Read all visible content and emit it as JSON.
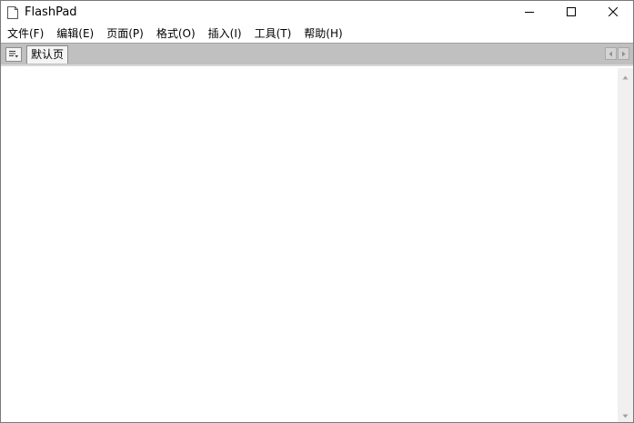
{
  "window": {
    "title": "FlashPad"
  },
  "icons": {
    "app": "document-icon",
    "minimize": "minimize-icon",
    "maximize": "maximize-icon",
    "close": "close-icon",
    "tab_menu": "list-menu-icon",
    "tab_scroll_left": "triangle-left-icon",
    "tab_scroll_right": "triangle-right-icon",
    "scroll_up": "triangle-up-icon",
    "scroll_down": "triangle-down-icon"
  },
  "menubar": {
    "items": [
      {
        "label": "文件(F)"
      },
      {
        "label": "编辑(E)"
      },
      {
        "label": "页面(P)"
      },
      {
        "label": "格式(O)"
      },
      {
        "label": "插入(I)"
      },
      {
        "label": "工具(T)"
      },
      {
        "label": "帮助(H)"
      }
    ]
  },
  "tabs": {
    "items": [
      {
        "label": "默认页"
      }
    ]
  },
  "editor": {
    "content": ""
  },
  "colors": {
    "tabstrip": "#c0c0c0",
    "window_border": "#7a7a7a"
  }
}
